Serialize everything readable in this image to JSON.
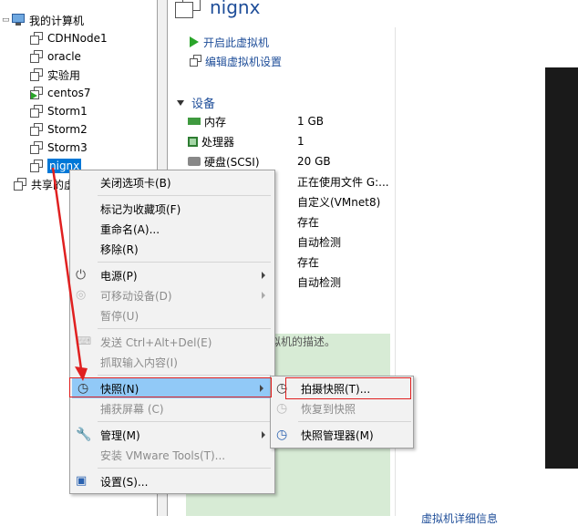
{
  "library": {
    "root_label": "我的计算机",
    "items": [
      {
        "label": "CDHNode1",
        "running": false
      },
      {
        "label": "oracle",
        "running": false
      },
      {
        "label": "实验用",
        "running": false
      },
      {
        "label": "centos7",
        "running": true
      },
      {
        "label": "Storm1",
        "running": false
      },
      {
        "label": "Storm2",
        "running": false
      },
      {
        "label": "Storm3",
        "running": false
      },
      {
        "label": "nignx",
        "running": false,
        "selected": true
      }
    ],
    "shared_label": "共享的虚"
  },
  "main": {
    "vm_title": "nignx",
    "actions": {
      "power_on": "开启此虚拟机",
      "edit_settings": "编辑虚拟机设置"
    },
    "devices_header": "设备",
    "devices": [
      {
        "name": "内存",
        "value": "1 GB",
        "icon": "memory-icon"
      },
      {
        "name": "处理器",
        "value": "1",
        "icon": "cpu-icon"
      },
      {
        "name": "硬盘(SCSI)",
        "value": "20 GB",
        "icon": "disk-icon"
      },
      {
        "name": "",
        "value": "正在使用文件 G:...",
        "icon": "cd-icon"
      },
      {
        "name": "",
        "value": "自定义(VMnet8)",
        "icon": "network-icon"
      },
      {
        "name": "",
        "value": "存在",
        "icon": "usb-icon"
      },
      {
        "name": "",
        "value": "自动检测",
        "icon": "sound-icon"
      },
      {
        "name": "",
        "value": "存在",
        "icon": "printer-icon"
      },
      {
        "name": "",
        "value": "自动检测",
        "icon": "display-icon"
      }
    ],
    "description_placeholder": "拟机的描述。",
    "details_link": "虚拟机详细信息"
  },
  "context_menu": {
    "items": [
      {
        "label": "关闭选项卡(B)",
        "enabled": true,
        "submenu": false,
        "icon": ""
      },
      {
        "label": "标记为收藏项(F)",
        "enabled": true,
        "submenu": false,
        "icon": ""
      },
      {
        "label": "重命名(A)...",
        "enabled": true,
        "submenu": false,
        "icon": ""
      },
      {
        "label": "移除(R)",
        "enabled": true,
        "submenu": false,
        "icon": ""
      },
      {
        "label": "电源(P)",
        "enabled": true,
        "submenu": true,
        "icon": "power-icon"
      },
      {
        "label": "可移动设备(D)",
        "enabled": false,
        "submenu": true,
        "icon": "removable-device-icon"
      },
      {
        "label": "暂停(U)",
        "enabled": false,
        "submenu": false,
        "icon": ""
      },
      {
        "label": "发送 Ctrl+Alt+Del(E)",
        "enabled": false,
        "submenu": false,
        "icon": "ctrl-alt-del-icon"
      },
      {
        "label": "抓取输入内容(I)",
        "enabled": false,
        "submenu": false,
        "icon": ""
      },
      {
        "label": "快照(N)",
        "enabled": true,
        "submenu": true,
        "icon": "snapshot-icon",
        "highlighted": true
      },
      {
        "label": "捕获屏幕 (C)",
        "enabled": false,
        "submenu": false,
        "icon": ""
      },
      {
        "label": "管理(M)",
        "enabled": true,
        "submenu": true,
        "icon": "wrench-icon"
      },
      {
        "label": "安装 VMware Tools(T)...",
        "enabled": false,
        "submenu": false,
        "icon": ""
      },
      {
        "label": "设置(S)...",
        "enabled": true,
        "submenu": false,
        "icon": "settings-icon"
      }
    ]
  },
  "snapshot_menu": {
    "items": [
      {
        "label": "拍摄快照(T)...",
        "enabled": true,
        "icon": "take-snapshot-icon"
      },
      {
        "label": "恢复到快照",
        "enabled": false,
        "icon": "revert-snapshot-icon"
      },
      {
        "label": "快照管理器(M)",
        "enabled": true,
        "icon": "snapshot-manager-icon"
      }
    ]
  },
  "colors": {
    "accent": "#1f4e99",
    "selection": "#0078d7",
    "menu_highlight": "#91c9f7",
    "annotation_red": "#e02020",
    "description_bg": "#d7ebd5"
  }
}
